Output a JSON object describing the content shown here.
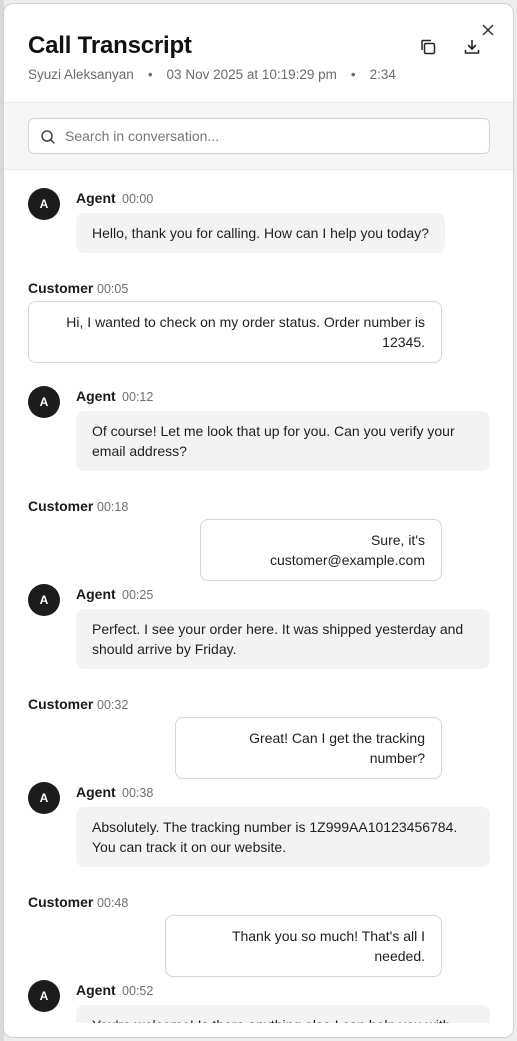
{
  "header": {
    "title": "Call Transcript",
    "caller": "Syuzi Aleksanyan",
    "separator": "•",
    "datetime": "03 Nov 2025 at 10:19:29 pm",
    "duration": "2:34",
    "icons": {
      "copy": "copy-icon",
      "download": "download-icon",
      "close": "close-icon"
    }
  },
  "search": {
    "placeholder": "Search in conversation...",
    "value": ""
  },
  "messages": [
    {
      "speaker": "Agent",
      "avatar": "A",
      "time": "00:00",
      "text": "Hello, thank you for calling. How can I help you today?"
    },
    {
      "speaker": "Customer",
      "time": "00:05",
      "text": "Hi, I wanted to check on my order status. Order number is 12345."
    },
    {
      "speaker": "Agent",
      "avatar": "A",
      "time": "00:12",
      "text": "Of course! Let me look that up for you. Can you verify your email address?"
    },
    {
      "speaker": "Customer",
      "time": "00:18",
      "text": "Sure, it's customer@example.com"
    },
    {
      "speaker": "Agent",
      "avatar": "A",
      "time": "00:25",
      "text": "Perfect. I see your order here. It was shipped yesterday and should arrive by Friday."
    },
    {
      "speaker": "Customer",
      "time": "00:32",
      "text": "Great! Can I get the tracking number?"
    },
    {
      "speaker": "Agent",
      "avatar": "A",
      "time": "00:38",
      "text": "Absolutely. The tracking number is 1Z999AA10123456784. You can track it on our website."
    },
    {
      "speaker": "Customer",
      "time": "00:48",
      "text": "Thank you so much! That's all I needed."
    },
    {
      "speaker": "Agent",
      "avatar": "A",
      "time": "00:52",
      "text": "You're welcome! Is there anything else I can help you with"
    }
  ],
  "colors": {
    "avatar_bg": "#1c1c1c",
    "agent_bubble": "#f3f3f3",
    "customer_border": "#d6d6d6",
    "muted_text": "#6b6b6b"
  }
}
